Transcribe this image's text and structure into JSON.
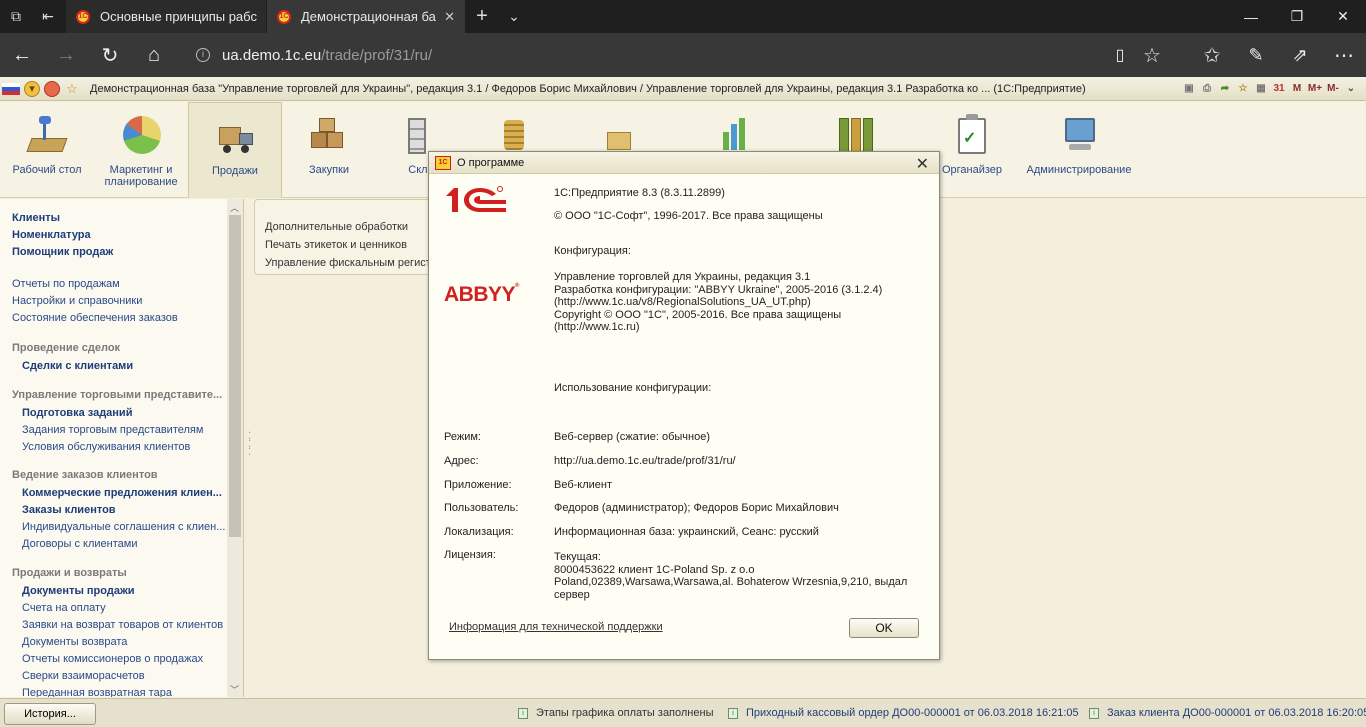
{
  "browser": {
    "tabs": [
      {
        "title": "Основные принципы рабс",
        "active": false
      },
      {
        "title": "Демонстрационная ба",
        "active": true
      }
    ],
    "url_host": "ua.demo.1c.eu",
    "url_path": "/trade/prof/31/ru/"
  },
  "onec": {
    "title": "Демонстрационная база \"Управление торговлей для Украины\", редакция 3.1 / Федоров Борис Михайлович / Управление торговлей для Украины, редакция 3.1 Разработка ко ... (1С:Предприятие)",
    "tools": [
      "M",
      "M+",
      "M-"
    ]
  },
  "sections": [
    {
      "label": "Рабочий стол",
      "icon": "desk-icon"
    },
    {
      "label": "Маркетинг и планирование",
      "icon": "pie-chart-icon"
    },
    {
      "label": "Продажи",
      "icon": "truck-icon",
      "active": true
    },
    {
      "label": "Закупки",
      "icon": "boxes-icon"
    },
    {
      "label": "Скла",
      "icon": "warehouse-icon"
    },
    {
      "label": "Органайзер",
      "icon": "clipboard-icon"
    },
    {
      "label": "Администрирование",
      "icon": "computer-icon"
    }
  ],
  "nav": {
    "top": [
      "Клиенты",
      "Номенклатура",
      "Помощник продаж"
    ],
    "reports": [
      "Отчеты по продажам",
      "Настройки и справочники",
      "Состояние обеспечения заказов"
    ],
    "g1": {
      "header": "Проведение сделок",
      "items": [
        "Сделки с клиентами"
      ]
    },
    "g2": {
      "header": "Управление торговыми представите...",
      "items": [
        "Подготовка заданий",
        "Задания торговым представителям",
        "Условия обслуживания клиентов"
      ]
    },
    "g3": {
      "header": "Ведение заказов клиентов",
      "items": [
        "Коммерческие предложения клиен...",
        "Заказы клиентов",
        "Индивидуальные соглашения с клиен...",
        "Договоры с клиентами"
      ]
    },
    "g4": {
      "header": "Продажи и возвраты",
      "items": [
        "Документы продажи",
        "Счета на оплату",
        "Заявки на возврат товаров от клиентов",
        "Документы возврата",
        "Отчеты комиссионеров о продажах",
        "Сверки взаиморасчетов",
        "Переданная возвратная тара"
      ]
    }
  },
  "panel": [
    "Дополнительные обработки",
    "Печать этикеток и ценников",
    "Управление фискальным регистр"
  ],
  "about": {
    "title": "О программе",
    "version": "1С:Предприятие 8.3 (8.3.11.2899)",
    "copyright": "© ООО \"1С-Софт\", 1996-2017. Все права защищены",
    "config_header": "Конфигурация:",
    "config_lines": [
      "Управление торговлей для Украины, редакция 3.1",
      "Разработка конфигурации: \"ABBYY Ukraine\", 2005-2016 (3.1.2.4)",
      "(http://www.1c.ua/v8/RegionalSolutions_UA_UT.php)",
      "Copyright © ООО \"1C\", 2005-2016. Все права защищены",
      "(http://www.1c.ru)"
    ],
    "usage_header": "Использование конфигурации:",
    "abbyy": "ABBYY",
    "rows": [
      {
        "label": "Режим:",
        "value": "Веб-сервер (сжатие: обычное)"
      },
      {
        "label": "Адрес:",
        "value": "http://ua.demo.1c.eu/trade/prof/31/ru/"
      },
      {
        "label": "Приложение:",
        "value": "Веб-клиент"
      },
      {
        "label": "Пользователь:",
        "value": "Федоров (администратор); Федоров Борис Михайлович"
      },
      {
        "label": "Локализация:",
        "value": "Информационная база: украинский, Сеанс: русский"
      }
    ],
    "license_label": "Лицензия:",
    "license_lines": [
      "Текущая:",
      "8000453622 клиент 1C-Poland Sp. z o.o",
      "Poland,02389,Warsawa,Warsawa,al. Bohaterow Wrzesnia,9,210, выдал",
      "сервер"
    ],
    "support_link": "Информация для технической поддержки",
    "ok": "OK"
  },
  "status": {
    "history": "История...",
    "notifications": [
      "Этапы графика оплаты заполнены",
      "Приходный кассовый ордер ДО00-000001 от 06.03.2018 16:21:05",
      "Заказ клиента ДО00-000001 от 06.03.2018 16:20:05"
    ]
  }
}
